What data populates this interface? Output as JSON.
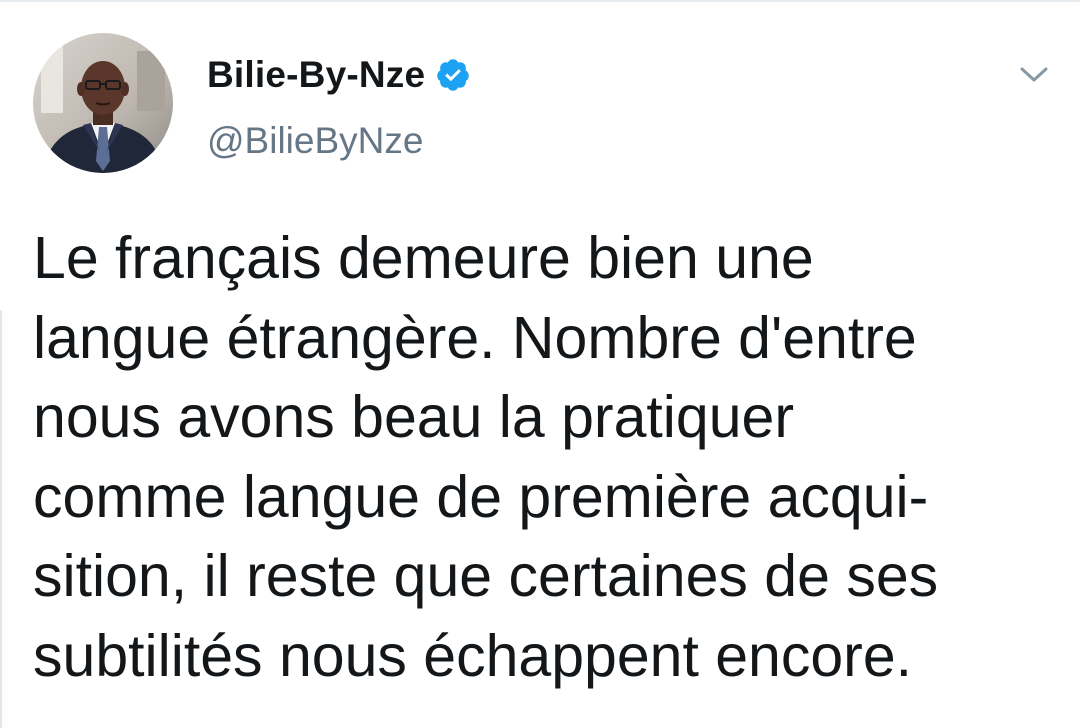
{
  "tweet": {
    "author": {
      "display_name": "Bilie-By-Nze",
      "handle": "@BilieByNze",
      "verified": true,
      "verified_color": "#1da1f2"
    },
    "text_lines": [
      "Le français demeure bien une",
      "langue étrangère. Nombre d'entre",
      "nous avons beau la pratiquer",
      "comme langue de première acqui-",
      "sition, il reste que certaines de ses",
      "subtilités nous échappent encore."
    ],
    "icons": {
      "verified": "verified-badge-icon",
      "menu": "chevron-down-icon"
    }
  }
}
